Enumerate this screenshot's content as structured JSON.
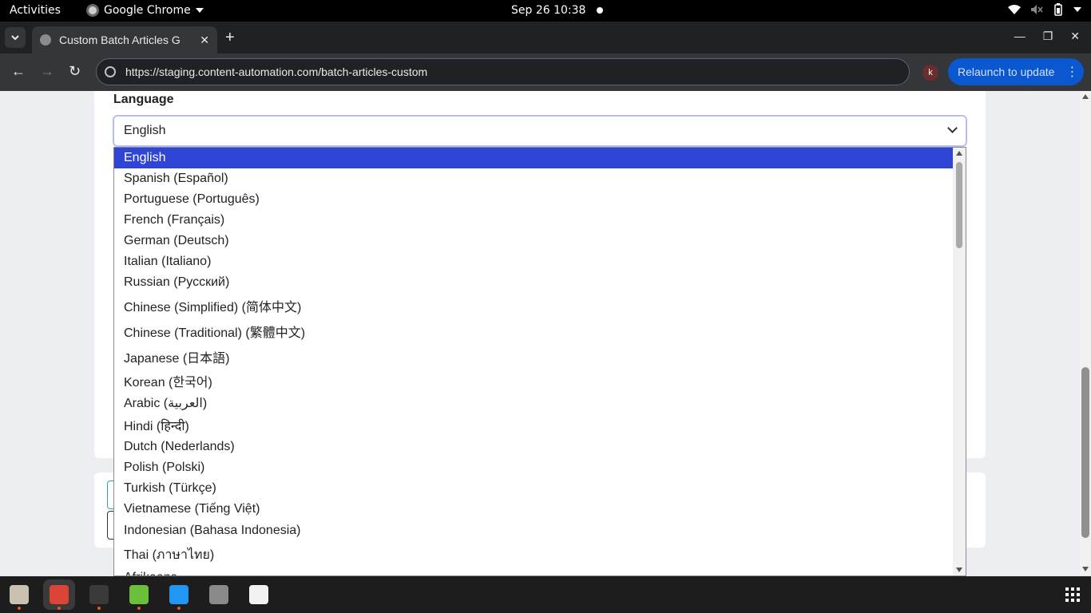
{
  "topbar": {
    "activities": "Activities",
    "app_name": "Google Chrome",
    "datetime": "Sep 26  10:38"
  },
  "tab": {
    "title": "Custom Batch Articles G",
    "close": "✕"
  },
  "toolbar": {
    "url": "https://staging.content-automation.com/batch-articles-custom",
    "profile_initial": "k",
    "relaunch_label": "Relaunch to update"
  },
  "form": {
    "language_label": "Language",
    "selected_language": "English"
  },
  "dropdown": {
    "options": [
      "English",
      "Spanish (Español)",
      "Portuguese (Português)",
      "French (Français)",
      "German (Deutsch)",
      "Italian (Italiano)",
      "Russian (Русский)",
      "Chinese (Simplified) (简体中文)",
      "Chinese (Traditional) (繁體中文)",
      "Japanese (日本語)",
      "Korean (한국어)",
      "Arabic (العربية)",
      "Hindi (हिन्दी)",
      "Dutch (Nederlands)",
      "Polish (Polski)",
      "Turkish (Türkçe)",
      "Vietnamese (Tiếng Việt)",
      "Indonesian (Bahasa Indonesia)",
      "Thai (ภาษาไทย)",
      "Afrikaans"
    ],
    "selected_index": 0
  },
  "dock": {
    "apps": [
      {
        "icon": "files-icon",
        "color": "#c9c2b2",
        "running": true
      },
      {
        "icon": "chrome-icon",
        "color": "#db4437",
        "running": true
      },
      {
        "icon": "terminal-icon",
        "color": "#3a3a3a",
        "running": true
      },
      {
        "icon": "text-editor-icon",
        "color": "#6bbf3a",
        "running": true
      },
      {
        "icon": "vscode-icon",
        "color": "#2196f3",
        "running": true
      },
      {
        "icon": "settings-icon",
        "color": "#8a8a8a",
        "running": false
      },
      {
        "icon": "screenshot-icon",
        "color": "#f2f2f2",
        "running": false
      }
    ]
  },
  "colors": {
    "selected_option": "#2e45d6",
    "relaunch_button": "#0b57d0",
    "select_focus_border": "#b9bdf3"
  }
}
